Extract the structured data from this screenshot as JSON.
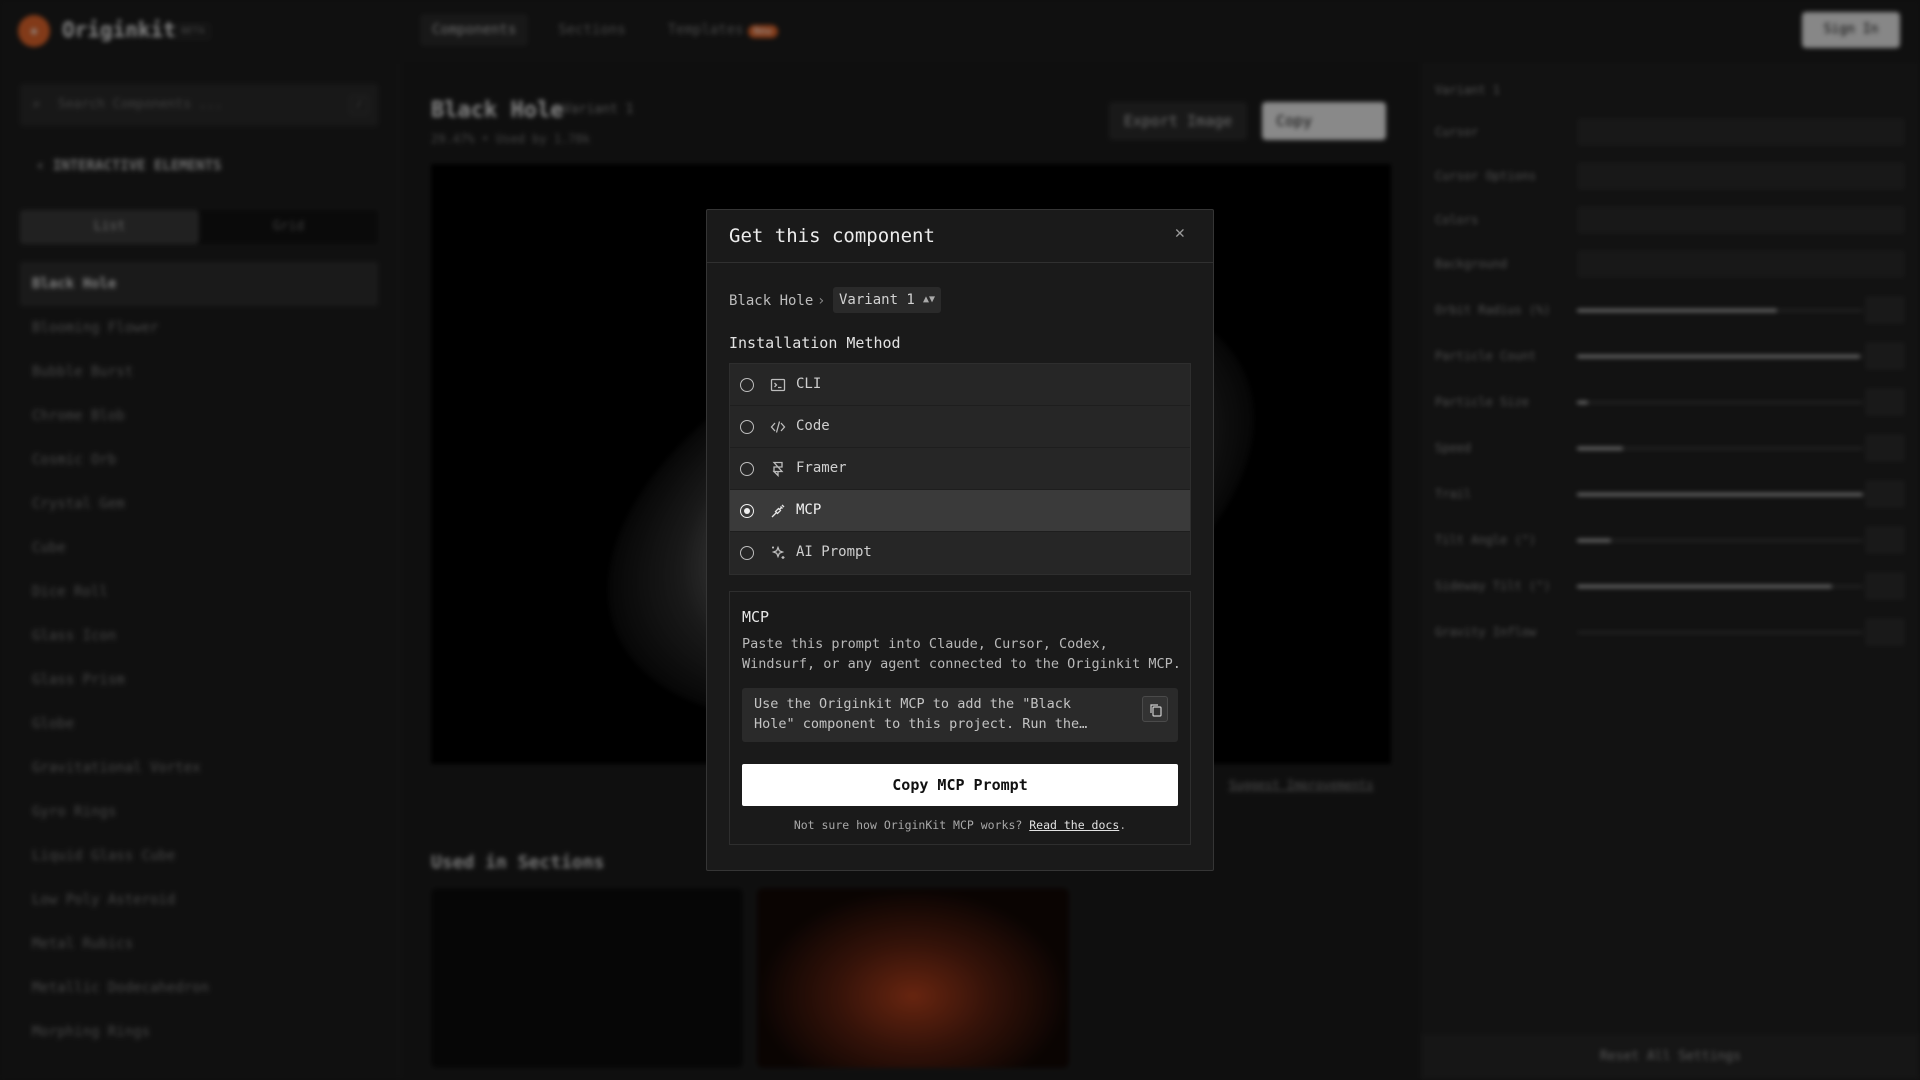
{
  "app": {
    "brand": "Originkit",
    "beta": "BETA",
    "nav": [
      "Components",
      "Sections",
      "Templates"
    ],
    "new_badge": "New",
    "signin": "Sign In"
  },
  "sidebar": {
    "search_placeholder": "Search Components ...",
    "kbd": "/",
    "section": "INTERACTIVE ELEMENTS",
    "view_list": "List",
    "view_grid": "Grid",
    "items": [
      "Black Hole",
      "Blooming Flower",
      "Bubble Burst",
      "Chrome Blob",
      "Cosmic Orb",
      "Crystal Gem",
      "Cube",
      "Dice Roll",
      "Glass Icon",
      "Glass Prism",
      "Globe",
      "Gravitational Vortex",
      "Gyro Rings",
      "Liquid Glass Cube",
      "Low Poly Asteroid",
      "Metal Rubics",
      "Metallic Dodecahedron",
      "Morphing Rings"
    ]
  },
  "main": {
    "title": "Black Hole",
    "variant": "Variant 1",
    "meta": "29.47% • Used by 1.78k",
    "export": "Export Image",
    "copy": "Copy",
    "suggest": "Suggest Improvements",
    "used_in": "Used in Sections"
  },
  "panel": {
    "variant": "Variant 1",
    "rows": [
      {
        "label": "Cursor"
      },
      {
        "label": "Cursor Options"
      },
      {
        "label": "Colors"
      },
      {
        "label": "Background"
      },
      {
        "label": "Orbit Radius (%)",
        "value": 0.7
      },
      {
        "label": "Particle Count",
        "value": 0.99
      },
      {
        "label": "Particle Size",
        "value": 0.04
      },
      {
        "label": "Speed",
        "value": 0.16
      },
      {
        "label": "Trail",
        "value": 1.0
      },
      {
        "label": "Tilt Angle (°)",
        "value": 0.12
      },
      {
        "label": "Sideway Tilt (°)",
        "value": 0.89
      },
      {
        "label": "Gravity Inflow",
        "value": 0.0
      }
    ],
    "reset": "Reset All Settings"
  },
  "modal": {
    "title": "Get this component",
    "breadcrumb_component": "Black Hole",
    "breadcrumb_sep": "›",
    "variant": "Variant 1",
    "installation_label": "Installation Method",
    "methods": [
      {
        "label": "CLI",
        "icon": "terminal-icon"
      },
      {
        "label": "Code",
        "icon": "code-icon"
      },
      {
        "label": "Framer",
        "icon": "framer-icon"
      },
      {
        "label": "MCP",
        "icon": "plug-icon"
      },
      {
        "label": "AI Prompt",
        "icon": "sparkles-icon"
      }
    ],
    "selected_method": "MCP",
    "info_title": "MCP",
    "info_desc": "Paste this prompt into Claude, Cursor, Codex, Windsurf, or any agent connected to the Originkit MCP.",
    "prompt_text": "Use the Originkit MCP to add the \"Black Hole\" component to this project. Run the…",
    "cta": "Copy MCP Prompt",
    "help_text": "Not sure how OriginKit MCP works?",
    "help_link": "Read the docs",
    "help_end": "."
  }
}
